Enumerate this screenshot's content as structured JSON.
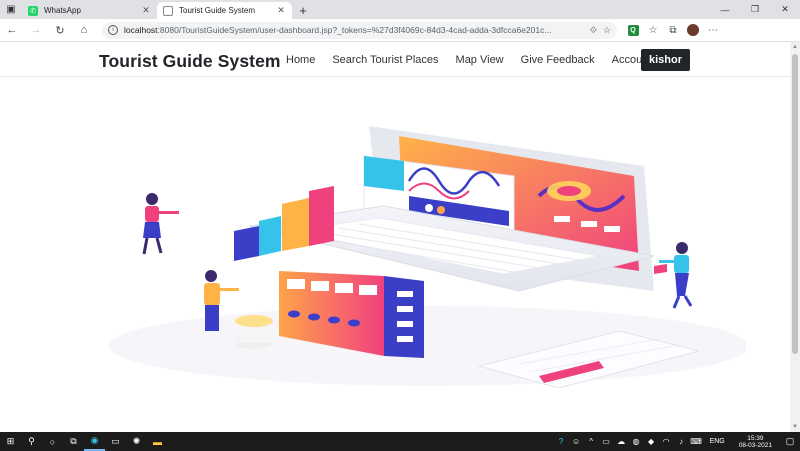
{
  "browser": {
    "tabs": [
      {
        "title": "WhatsApp",
        "active": false,
        "favicon_color": "#25d366",
        "icon": "whatsapp-icon"
      },
      {
        "title": "Tourist Guide System",
        "active": true,
        "favicon_color": "#ffffff",
        "icon": "page-icon"
      }
    ],
    "url_host": "localhost",
    "url_path": ":8080/TouristGuideSystem/user-dashboard.jsp?_tokens=%27d3f4069c-84d3-4cad-adda-3dfcca6e201c..."
  },
  "site": {
    "brand": "Tourist Guide System",
    "menu": {
      "home": "Home",
      "search": "Search Tourist Places",
      "map": "Map View",
      "feedback": "Give Feedback",
      "account": "Account"
    },
    "user": "kishor"
  },
  "taskbar": {
    "lang": "ENG",
    "time": "15:39",
    "date": "08-03-2021"
  },
  "colors": {
    "accent_dark": "#212529",
    "hero_pink": "#f0417f",
    "hero_orange": "#ffa34a",
    "hero_blue": "#3b3fc8",
    "hero_cyan": "#35c3ea"
  }
}
